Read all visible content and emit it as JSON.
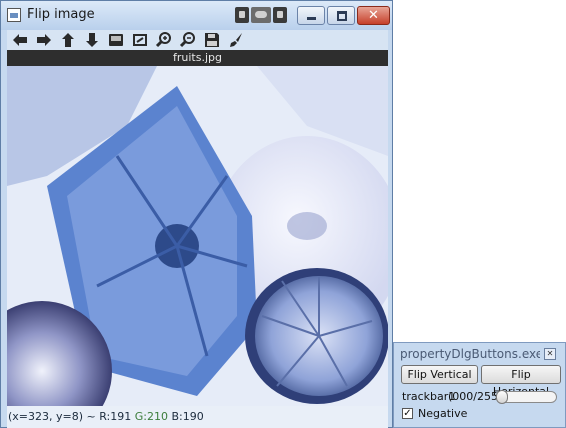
{
  "window": {
    "title": "Flip image",
    "file_name": "fruits.jpg",
    "close_glyph": "✕"
  },
  "toolbar": {
    "icons": [
      "arrow-left-icon",
      "arrow-right-icon",
      "arrow-up-icon",
      "arrow-down-icon",
      "save-image-icon",
      "fit-window-icon",
      "zoom-in-icon",
      "zoom-out-icon",
      "save-icon",
      "brush-icon"
    ]
  },
  "status": {
    "coords": "(x=323, y=8) ~ ",
    "r": "R:191",
    "g": "G:210",
    "b": "B:190"
  },
  "dialog": {
    "title": "propertyDlgButtons.exe set...",
    "close_glyph": "✕",
    "flip_vertical": "Flip Vertical",
    "flip_horizontal": "Flip Horizontal",
    "trackbar_label": "trackbar1",
    "trackbar_value": "(000/255)",
    "trackbar_level": 0,
    "checkbox_mark": "✓",
    "checkbox_label": "Negative",
    "checkbox_checked": true
  },
  "colors": {
    "window_frame": "#c6d9ef",
    "title_bar": "#b9d0ec",
    "file_bar": "#2e2e2e",
    "close_button": "#c6402b"
  }
}
